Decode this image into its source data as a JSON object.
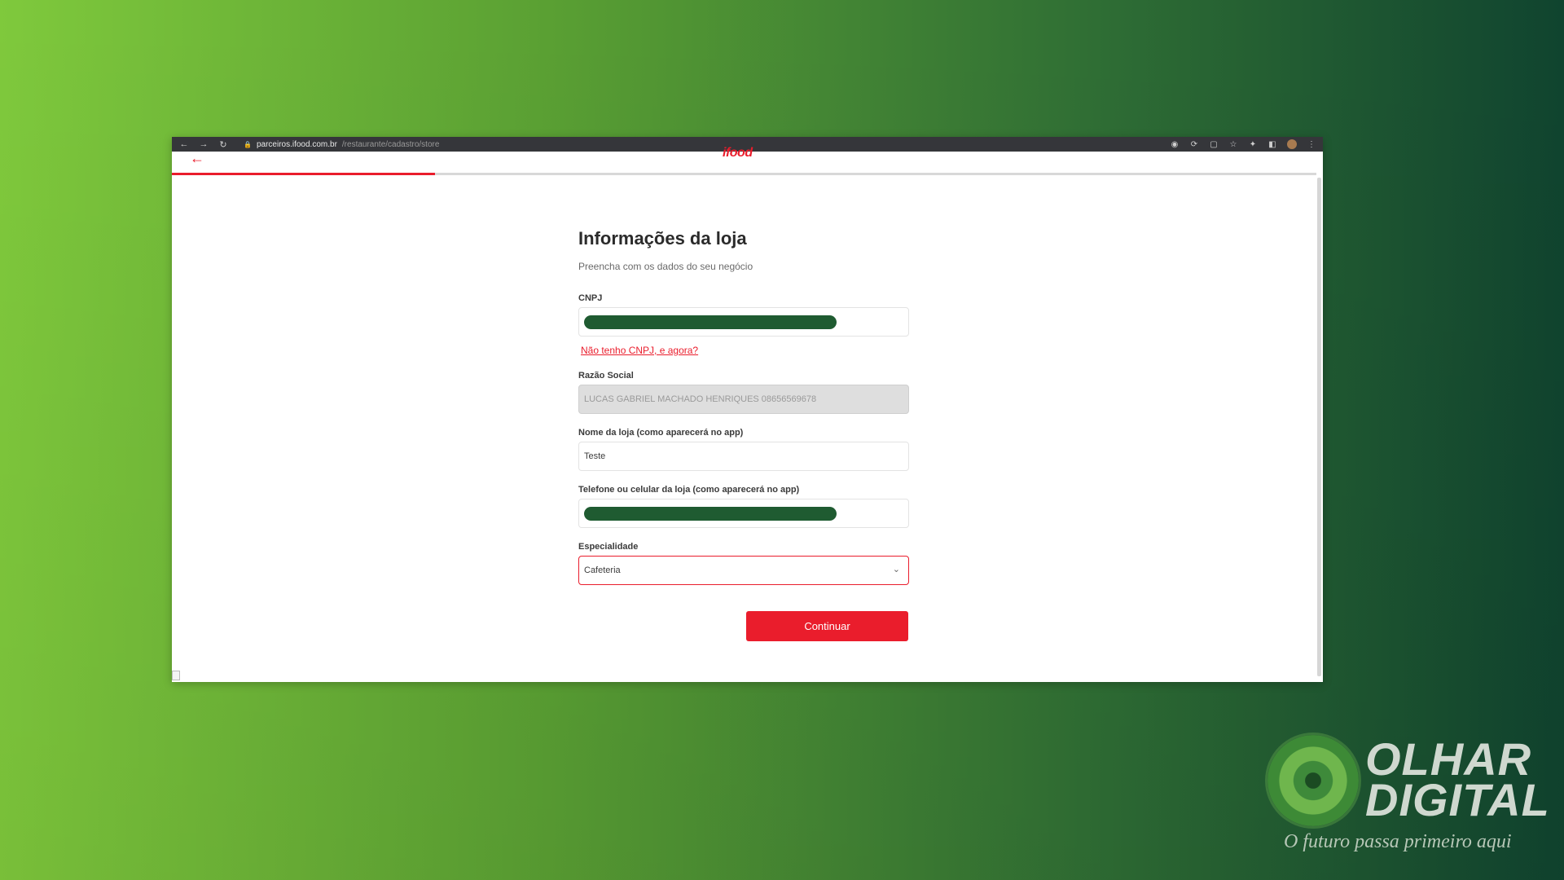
{
  "browser": {
    "url_host": "parceiros.ifood.com.br",
    "url_path": "/restaurante/cadastro/store"
  },
  "header": {
    "logo_text": "ifood",
    "progress_fraction": 0.23
  },
  "form": {
    "title": "Informações da loja",
    "subtitle": "Preencha com os dados do seu negócio",
    "cnpj_label": "CNPJ",
    "no_cnpj_link": "Não tenho CNPJ, e agora?",
    "razao_label": "Razão Social",
    "razao_value": "LUCAS GABRIEL MACHADO HENRIQUES 08656569678",
    "nome_label": "Nome da loja (como aparecerá no app)",
    "nome_value": "Teste",
    "telefone_label": "Telefone ou celular da loja (como aparecerá no app)",
    "especialidade_label": "Especialidade",
    "especialidade_value": "Cafeteria",
    "continue_label": "Continuar"
  },
  "brand": {
    "word1": "OLHAR",
    "word2": "DIGITAL",
    "tagline": "O futuro passa primeiro aqui"
  },
  "colors": {
    "accent": "#ea1d2c",
    "redaction": "#1f5b31"
  }
}
